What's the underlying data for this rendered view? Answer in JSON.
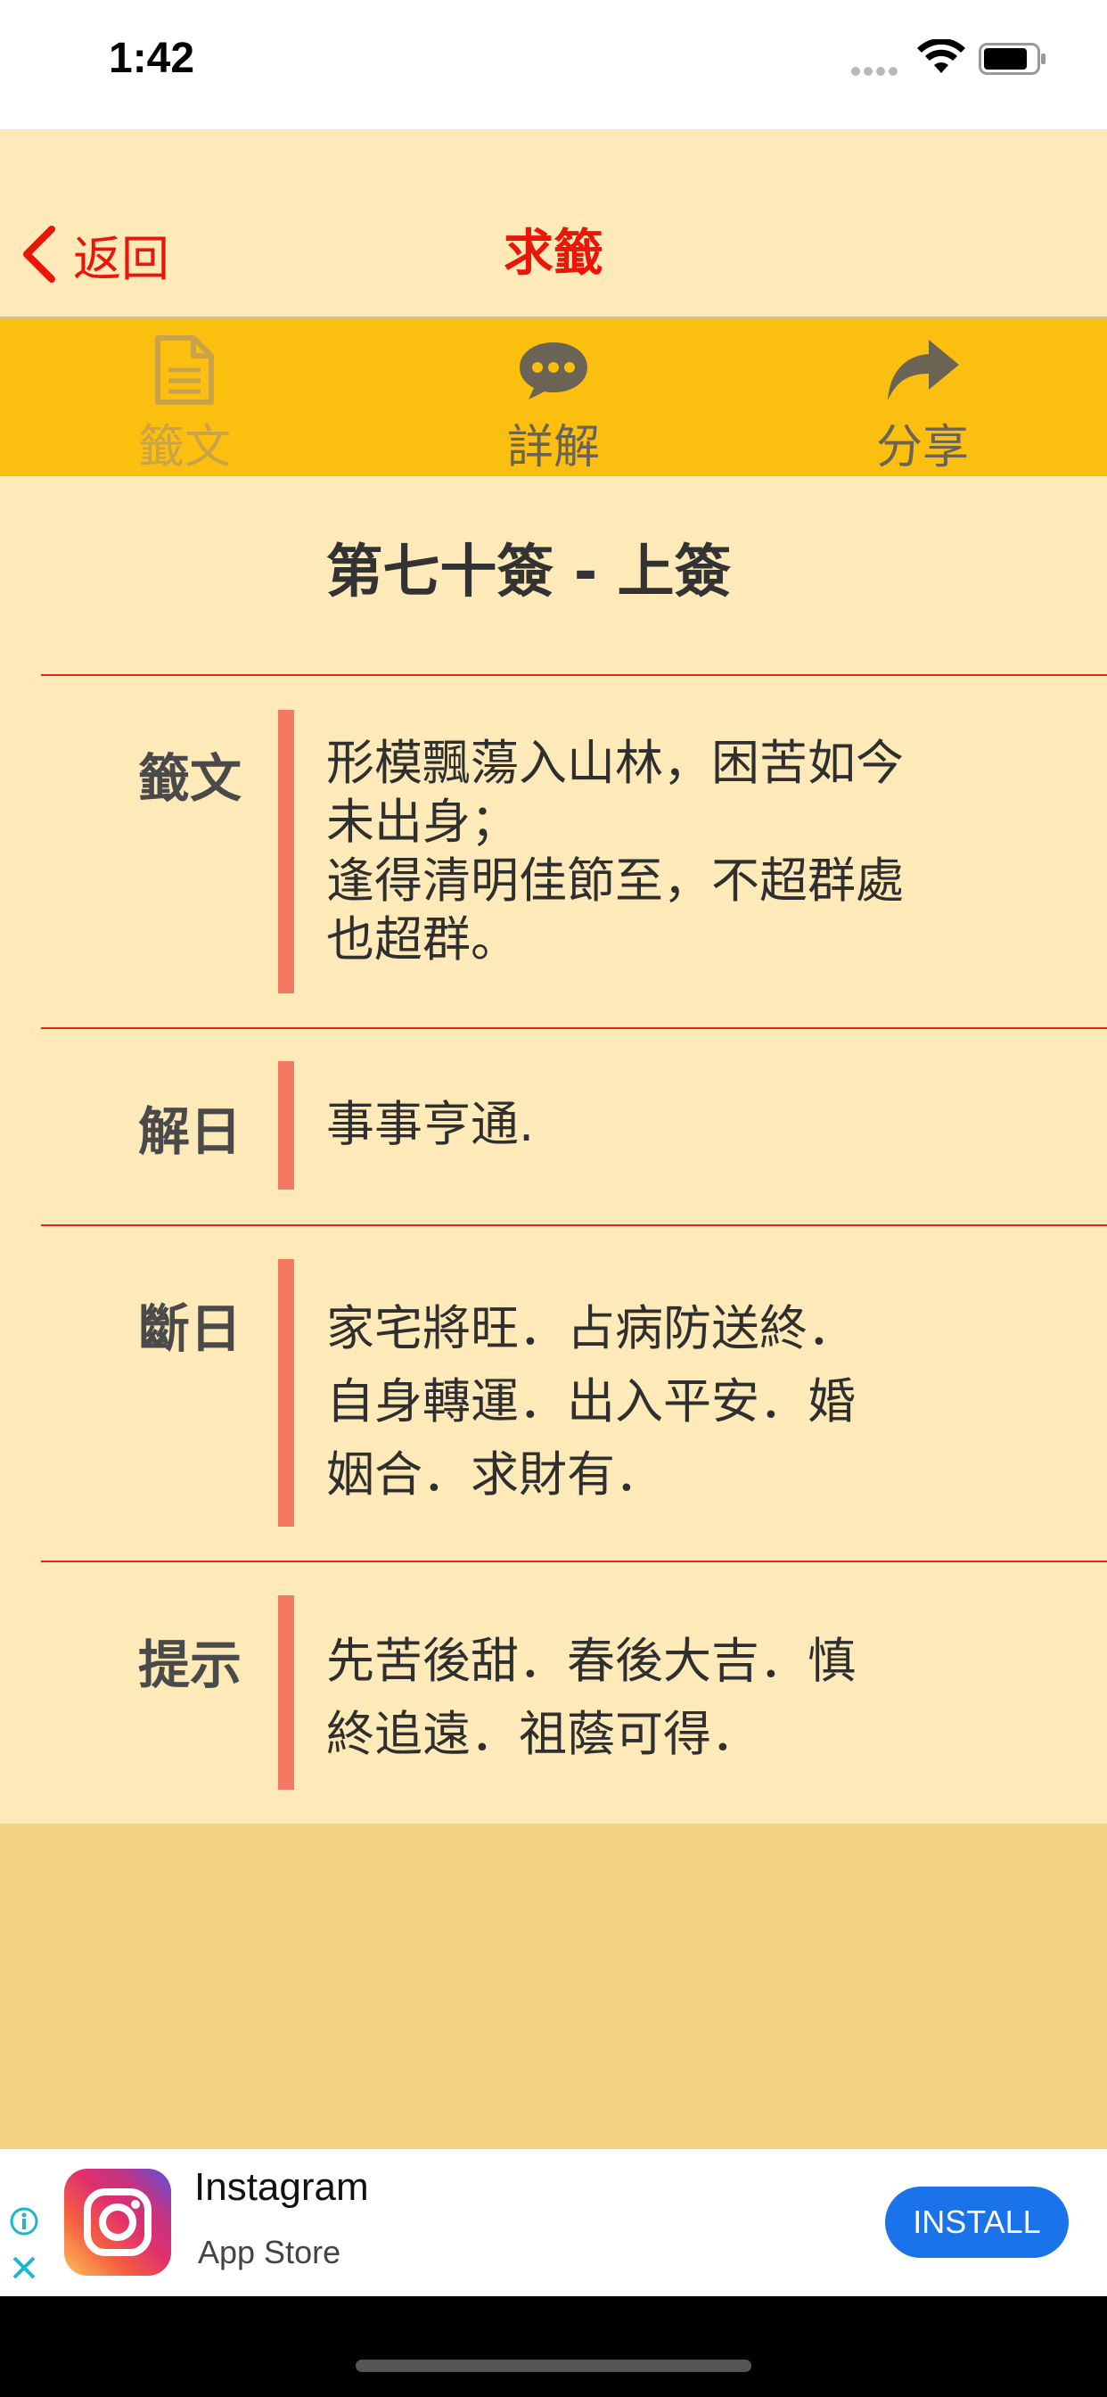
{
  "status_bar": {
    "time": "1:42"
  },
  "nav": {
    "back_label": "返回",
    "title": "求籤"
  },
  "tabs": [
    {
      "label": "籤文",
      "icon": "document-icon",
      "state": "inactive"
    },
    {
      "label": "詳解",
      "icon": "chat-bubble-icon",
      "state": "active"
    },
    {
      "label": "分享",
      "icon": "share-arrow-icon",
      "state": "active"
    }
  ],
  "heading": "第七十簽 - 上簽",
  "sections": [
    {
      "label": "籤文",
      "text": "形模飄蕩入山林，困苦如今\n未出身；\n逢得清明佳節至，不超群處\n也超群。"
    },
    {
      "label": "解日",
      "text": "事事亨通."
    },
    {
      "label": "斷日",
      "text": "家宅將旺．占病防送終．\n自身轉運．出入平安．婚\n姻合．求財有．"
    },
    {
      "label": "提示",
      "text": "先苦後甜．春後大吉．慎\n終追遠．祖蔭可得．"
    }
  ],
  "ad": {
    "app_name": "Instagram",
    "store": "App Store",
    "cta": "INSTALL"
  },
  "colors": {
    "accent_red": "#e8170a",
    "tab_bar": "#fbbf10",
    "background": "#fdeab8",
    "section_bar": "#f57961"
  }
}
